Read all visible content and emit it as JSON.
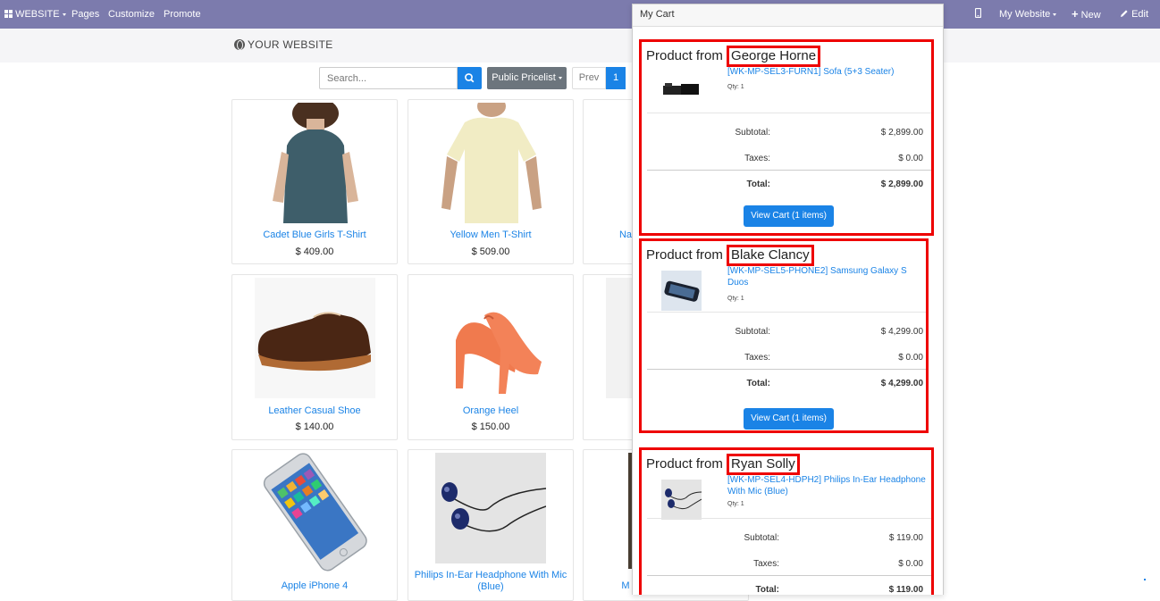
{
  "topbar": {
    "website_label": "WEBSITE",
    "pages": "Pages",
    "customize": "Customize",
    "promote": "Promote",
    "my_website": "My Website",
    "new_label": "New",
    "edit_label": "Edit",
    "bg_color": "#7c7bad"
  },
  "header": {
    "logo": "YOUR WEBSITE"
  },
  "shop": {
    "search_placeholder": "Search...",
    "pricelist": "Public Pricelist",
    "pager_prev": "Prev",
    "pager_current": "1",
    "products": [
      {
        "name": "Cadet Blue Girls T-Shirt",
        "price": "$ 409.00"
      },
      {
        "name": "Yellow Men T-Shirt",
        "price": "$ 509.00"
      },
      {
        "name": "Na",
        "price": ""
      },
      {
        "name": "Leather Casual Shoe",
        "price": "$ 140.00"
      },
      {
        "name": "Orange Heel",
        "price": "$ 150.00"
      },
      {
        "name": "Apple iPhone 4",
        "price": ""
      },
      {
        "name": "Philips In-Ear Headphone With Mic (Blue)",
        "price": ""
      },
      {
        "name": "M",
        "price": ""
      }
    ]
  },
  "cart": {
    "title": "My Cart",
    "prefix": "Product from",
    "sellers": [
      {
        "name": "George Horne",
        "product": "[WK-MP-SEL3-FURN1] Sofa (5+3 Seater)",
        "qty": "Qty: 1",
        "subtotal_label": "Subtotal:",
        "subtotal": "$ 2,899.00",
        "taxes_label": "Taxes:",
        "taxes": "$ 0.00",
        "total_label": "Total:",
        "total": "$ 2,899.00",
        "button": "View Cart (1 items)"
      },
      {
        "name": "Blake Clancy",
        "product": "[WK-MP-SEL5-PHONE2] Samsung Galaxy S Duos",
        "qty": "Qty: 1",
        "subtotal_label": "Subtotal:",
        "subtotal": "$ 4,299.00",
        "taxes_label": "Taxes:",
        "taxes": "$ 0.00",
        "total_label": "Total:",
        "total": "$ 4,299.00",
        "button": "View Cart (1 items)"
      },
      {
        "name": "Ryan Solly",
        "product": "[WK-MP-SEL4-HDPH2] Philips In-Ear Headphone With Mic (Blue)",
        "qty": "Qty: 1",
        "subtotal_label": "Subtotal:",
        "subtotal": "$ 119.00",
        "taxes_label": "Taxes:",
        "taxes": "$ 0.00",
        "total_label": "Total:",
        "total": "$ 119.00"
      }
    ]
  }
}
